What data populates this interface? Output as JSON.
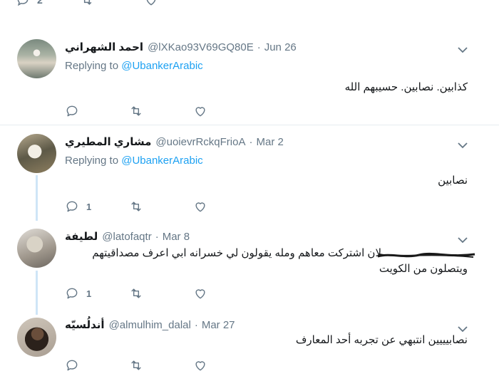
{
  "top_partial": {
    "reply_count": "2"
  },
  "tweets": [
    {
      "name": "احمد الشهراني",
      "handle": "@lXKao93V69GQ80E",
      "date": "Jun 26",
      "replying_prefix": "Replying to",
      "replying_target": "@UbankerArabic",
      "text": "كذابين. نصابين. حسيبهم الله",
      "reply_count": "",
      "icons": {
        "reply": "reply-icon",
        "retweet": "retweet-icon",
        "like": "heart-icon"
      }
    },
    {
      "name": "مشاري المطيري",
      "handle": "@uoievrRckqFrioA",
      "date": "Mar 2",
      "replying_prefix": "Replying to",
      "replying_target": "@UbankerArabic",
      "text": "نصابين",
      "reply_count": "1"
    },
    {
      "name": "لطيفة",
      "handle": "@latofaqtr",
      "date": "Mar 8",
      "text_line1": "لان اشتركت معاهم ومله يقولون لي خسرانه ابي اعرف مصداقيتهم",
      "text_line2": "ويتصلون من الكويت",
      "reply_count": "1"
    },
    {
      "name": "أندلُسيّه",
      "handle": "@almulhim_dalal",
      "date": "Mar 27",
      "text": "نصابيييين انتبهي عن تجربه أحد المعارف",
      "reply_count": ""
    }
  ],
  "separator": "·",
  "colors": {
    "link": "#1da1f2",
    "muted": "#657786",
    "thread_line": "#cfe5f7",
    "border": "#e6ecf0"
  }
}
